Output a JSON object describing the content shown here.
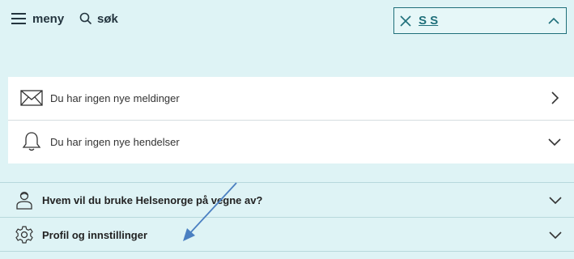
{
  "topbar": {
    "menu_label": "meny",
    "search_label": "søk",
    "user_name": "S    S",
    "menu_icon": "hamburger-icon",
    "search_icon": "search-icon",
    "close_icon": "close-icon",
    "chevron_icon": "chevron-up-icon"
  },
  "notifications": [
    {
      "label": "Du har ingen nye meldinger",
      "icon": "envelope-icon",
      "chevron": "chevron-right-icon"
    },
    {
      "label": "Du har ingen nye hendelser",
      "icon": "bell-icon",
      "chevron": "chevron-down-icon"
    }
  ],
  "accordion": [
    {
      "label": "Hvem vil du bruke Helsenorge på vegne av?",
      "icon": "person-icon",
      "chevron": "chevron-down-icon"
    },
    {
      "label": "Profil og innstillinger",
      "icon": "gear-icon",
      "chevron": "chevron-down-icon"
    }
  ],
  "colors": {
    "background": "#def3f5",
    "accent": "#1f6f7a",
    "arrow": "#4a7fc1"
  }
}
